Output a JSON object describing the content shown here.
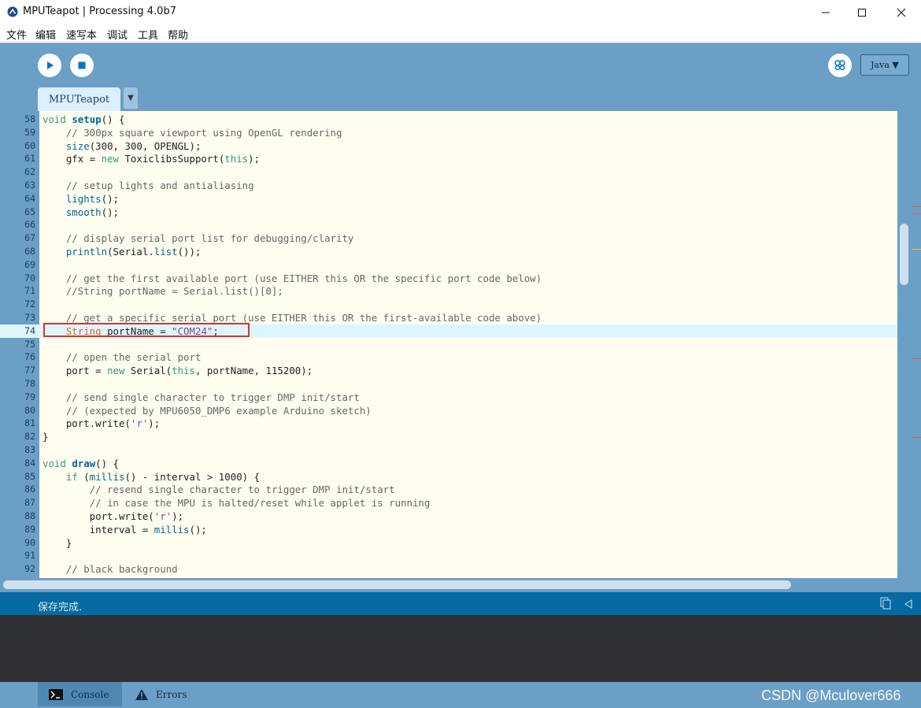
{
  "window": {
    "title": "MPUTeapot | Processing 4.0b7"
  },
  "menu": [
    "文件",
    "编辑",
    "速写本",
    "调试",
    "工具",
    "帮助"
  ],
  "toolbar": {
    "mode": "Java ▼"
  },
  "tabs": [
    {
      "label": "MPUTeapot"
    }
  ],
  "tab_menu_glyph": "▼",
  "editor": {
    "highlighted_line": 74,
    "lines": [
      {
        "n": "58",
        "t": "void setup() {"
      },
      {
        "n": "59",
        "t": "    // 300px square viewport using OpenGL rendering"
      },
      {
        "n": "60",
        "t": "    size(300, 300, OPENGL);"
      },
      {
        "n": "61",
        "t": "    gfx = new ToxiclibsSupport(this);"
      },
      {
        "n": "62",
        "t": ""
      },
      {
        "n": "63",
        "t": "    // setup lights and antialiasing"
      },
      {
        "n": "64",
        "t": "    lights();"
      },
      {
        "n": "65",
        "t": "    smooth();"
      },
      {
        "n": "66",
        "t": ""
      },
      {
        "n": "67",
        "t": "    // display serial port list for debugging/clarity"
      },
      {
        "n": "68",
        "t": "    println(Serial.list());"
      },
      {
        "n": "69",
        "t": ""
      },
      {
        "n": "70",
        "t": "    // get the first available port (use EITHER this OR the specific port code below)"
      },
      {
        "n": "71",
        "t": "    //String portName = Serial.list()[0];"
      },
      {
        "n": "72",
        "t": ""
      },
      {
        "n": "73",
        "t": "    // get a specific serial port (use EITHER this OR the first-available code above)"
      },
      {
        "n": "74",
        "t": "    String portName = \"COM24\";"
      },
      {
        "n": "75",
        "t": ""
      },
      {
        "n": "76",
        "t": "    // open the serial port"
      },
      {
        "n": "77",
        "t": "    port = new Serial(this, portName, 115200);"
      },
      {
        "n": "78",
        "t": ""
      },
      {
        "n": "79",
        "t": "    // send single character to trigger DMP init/start"
      },
      {
        "n": "80",
        "t": "    // (expected by MPU6050_DMP6 example Arduino sketch)"
      },
      {
        "n": "81",
        "t": "    port.write('r');"
      },
      {
        "n": "82",
        "t": "}"
      },
      {
        "n": "83",
        "t": ""
      },
      {
        "n": "84",
        "t": "void draw() {"
      },
      {
        "n": "85",
        "t": "    if (millis() - interval > 1000) {"
      },
      {
        "n": "86",
        "t": "        // resend single character to trigger DMP init/start"
      },
      {
        "n": "87",
        "t": "        // in case the MPU is halted/reset while applet is running"
      },
      {
        "n": "88",
        "t": "        port.write('r');"
      },
      {
        "n": "89",
        "t": "        interval = millis();"
      },
      {
        "n": "90",
        "t": "    }"
      },
      {
        "n": "91",
        "t": ""
      },
      {
        "n": "92",
        "t": "    // black background"
      }
    ]
  },
  "status": {
    "message": "保存完成."
  },
  "bottom_tabs": [
    {
      "label": "Console"
    },
    {
      "label": "Errors"
    }
  ],
  "watermark": "CSDN @Mculover666",
  "colors": {
    "accent": "#6b9fc5",
    "status": "#046aa1",
    "keyword": "#33997e",
    "type": "#e2661a",
    "comment": "#666666",
    "string": "#7d4793",
    "function": "#006699"
  }
}
